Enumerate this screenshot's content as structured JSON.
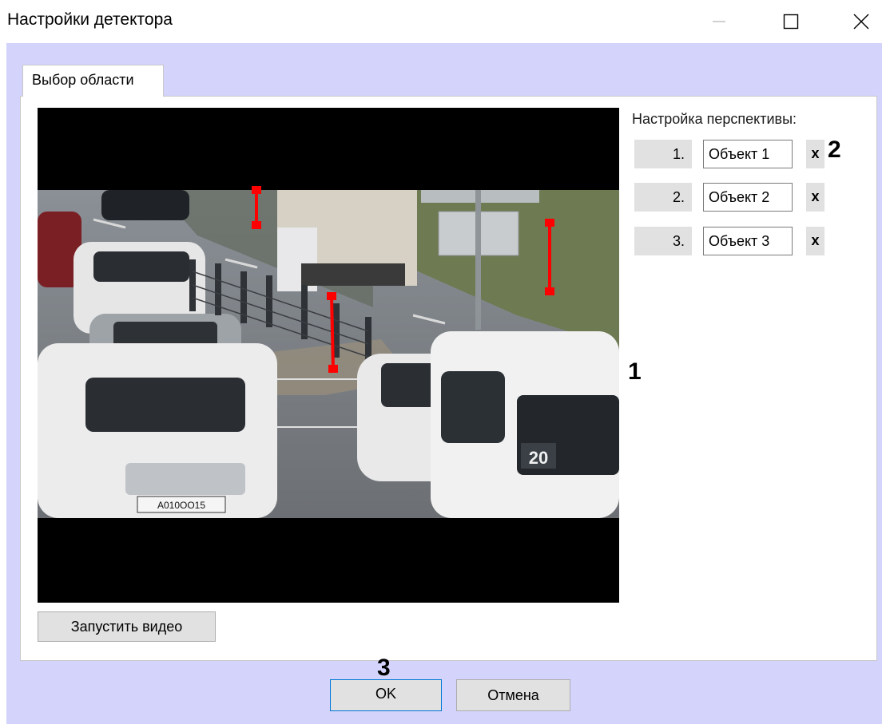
{
  "window": {
    "title": "Настройки детектора",
    "controls": [
      "minimize-icon",
      "maximize-icon",
      "close-icon"
    ]
  },
  "tabs": [
    {
      "label": "Выбор области",
      "active": true
    }
  ],
  "perspective": {
    "label": "Настройка перспективы:",
    "rows": [
      {
        "number": "1.",
        "name": "Объект 1",
        "remove": "x"
      },
      {
        "number": "2.",
        "name": "Объект 2",
        "remove": "x"
      },
      {
        "number": "3.",
        "name": "Объект 3",
        "remove": "x"
      }
    ]
  },
  "video": {
    "plate_text": "A010OO15",
    "route_number": "20"
  },
  "buttons": {
    "start_video": "Запустить видео",
    "ok": "OK",
    "cancel": "Отмена"
  },
  "callouts": {
    "c1": "1",
    "c2": "2",
    "c3": "3"
  },
  "colors": {
    "client_bg": "#d3d3fb",
    "button_bg": "#e1e1e1",
    "marker_red": "#ff0000"
  }
}
